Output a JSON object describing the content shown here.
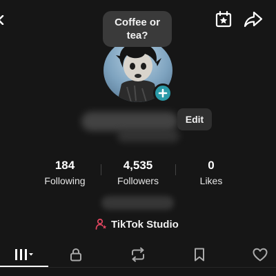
{
  "profile": {
    "bubble_text": "Coffee or tea?",
    "edit_label": "Edit"
  },
  "stats": [
    {
      "value": "184",
      "label": "Following"
    },
    {
      "value": "4,535",
      "label": "Followers"
    },
    {
      "value": "0",
      "label": "Likes"
    }
  ],
  "studio": {
    "label": "TikTok Studio"
  },
  "icons": {
    "top_left": "back-icon",
    "top_right": [
      "calendar-star-icon",
      "share-icon"
    ],
    "tabs": [
      "grid-icon",
      "lock-icon",
      "repost-icon",
      "bookmark-icon",
      "heart-icon"
    ]
  },
  "colors": {
    "background": "#161616",
    "add_button": "#2a9aa8",
    "studio_icon": "#e0455f"
  }
}
